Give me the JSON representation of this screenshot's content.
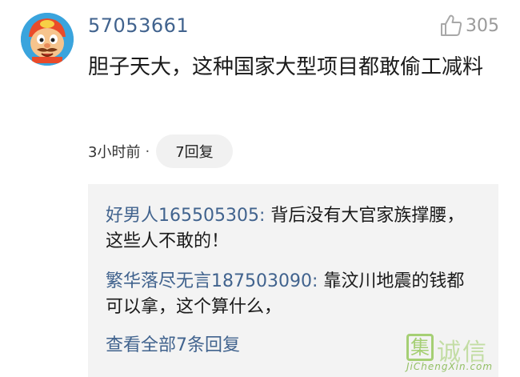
{
  "comment": {
    "username": "57053661",
    "avatar_icon": "cartoon-avatar-icon",
    "like_icon": "thumbs-up-icon",
    "like_count": "305",
    "text": "胆子天大，这种国家大型项目都敢偷工减料",
    "time": "3小时前",
    "separator": "·",
    "reply_count_label": "7回复"
  },
  "replies": {
    "items": [
      {
        "author": "好男人165505305",
        "separator": ":",
        "text": " 背后没有大官家族撑腰，这些人不敢的！"
      },
      {
        "author": "繁华落尽无言187503090",
        "separator": ":",
        "text": " 靠汶川地震的钱都可以拿，这个算什么，"
      }
    ],
    "view_all_label": "查看全部7条回复"
  },
  "watermark": {
    "box_char": "集",
    "text": "诚信",
    "url": "JiChengXin.com"
  },
  "colors": {
    "link_blue": "#41638e",
    "reply_bg": "#f3f3f3",
    "pill_bg": "#f1f1f1",
    "muted": "#9a9a9a"
  }
}
